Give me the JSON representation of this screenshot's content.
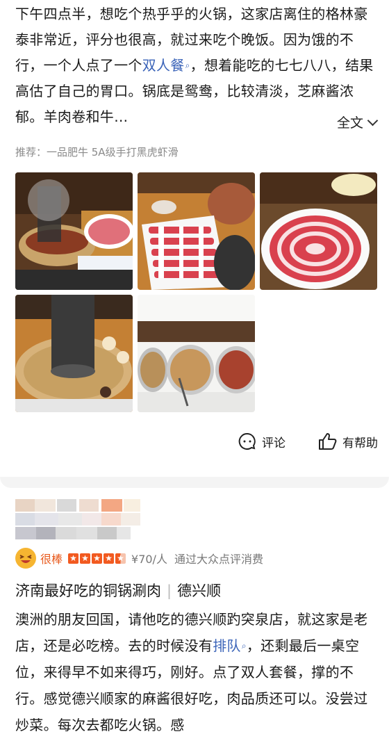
{
  "review1": {
    "p1": "下午四点半，想吃个热乎乎的火锅，这家店离住的格林豪泰非常近，评分也很高，就过来吃个晚饭。因为饿的不行，一个人点了一个",
    "kw1": "双人餐",
    "p2": "，想着能吃的七七八八，结果高估了自己的胃口。锅底是鸳鸯，比较清淡，芝麻酱浓郁。羊肉卷和牛…",
    "more": "全文",
    "recs": "推荐：一品肥牛 5A级手打黑虎虾滑",
    "photos": [
      "copper-hotpot-steam",
      "sliced-beef-plate",
      "sliced-beef-plate-tray",
      "beef-roll-plate",
      "copper-hotpot-broth",
      "sauce-bowls"
    ],
    "comment": "评论",
    "helpful": "有帮助"
  },
  "review2": {
    "badge": "很棒",
    "stars": 4.5,
    "price": "¥70/人",
    "via": "通过大众点评消费",
    "title": "济南最好吃的铜锅涮肉",
    "sep": "|",
    "shop": "德兴顺",
    "p1": "澳洲的朋友回国，请他吃的德兴顺趵突泉店，就这家是老店，还是必吃榜。去的时候没有",
    "kw1": "排队",
    "p2": "，还剩最后一桌空位，来得早不如来得巧，刚好。点了双人套餐，撑的不行。感觉德兴顺家的麻酱很好吃，肉品质还可以。没尝过炒菜。每次去都吃火锅。感"
  },
  "colors": {
    "link": "#3a63b8",
    "accent": "#f25a20"
  }
}
